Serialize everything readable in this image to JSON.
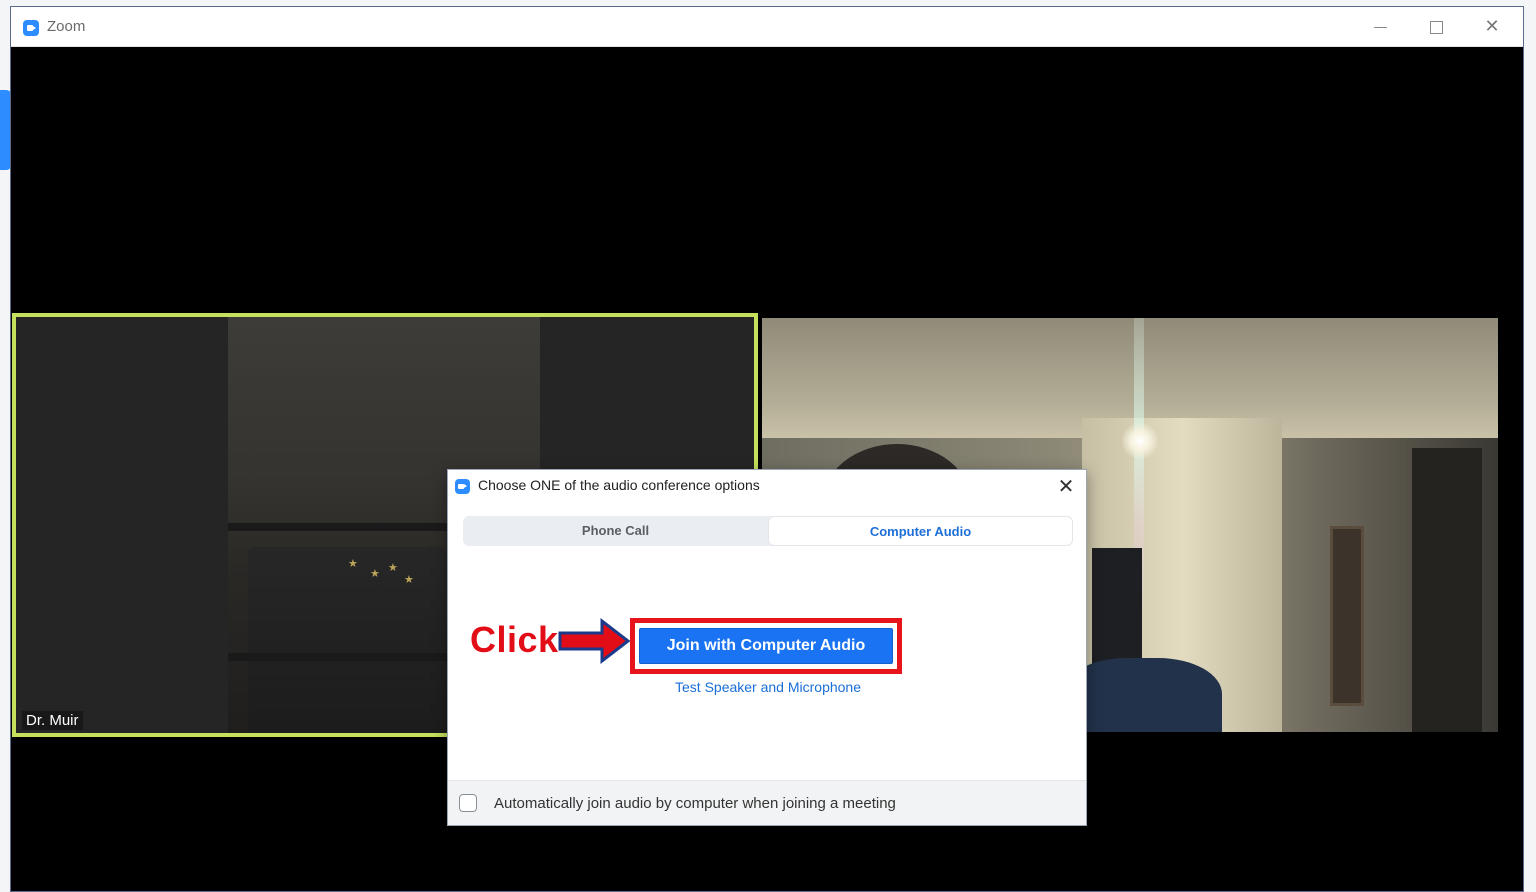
{
  "window": {
    "title": "Zoom"
  },
  "participants": [
    {
      "name": "Dr. Muir",
      "active_speaker": true
    },
    {
      "name": "",
      "active_speaker": false
    }
  ],
  "dialog": {
    "title": "Choose ONE of the audio conference options",
    "tabs": [
      {
        "label": "Phone Call",
        "selected": false
      },
      {
        "label": "Computer Audio",
        "selected": true
      }
    ],
    "join_button_label": "Join with Computer Audio",
    "test_link_label": "Test Speaker and Microphone",
    "auto_join_label": "Automatically join audio by computer when joining a meeting",
    "auto_join_checked": false
  },
  "annotation": {
    "click_label": "Click",
    "color": "#e30d17"
  },
  "colors": {
    "accent": "#1a73f2",
    "active_speaker_border": "#c4e05c",
    "highlight_box": "#e8141c"
  },
  "icons": {
    "app_logo": "zoom-camera-icon",
    "minimize": "minimize-icon",
    "maximize": "maximize-icon",
    "close": "close-icon",
    "dialog_close": "close-icon"
  }
}
